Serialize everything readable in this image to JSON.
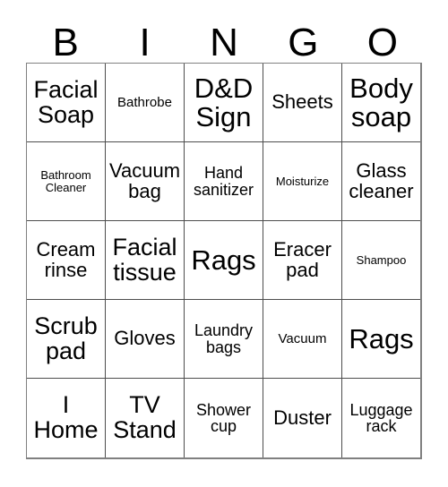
{
  "card": {
    "title": "BINGO",
    "headers": [
      "B",
      "I",
      "N",
      "G",
      "O"
    ],
    "rows": [
      [
        {
          "text": "Facial\nSoap",
          "size": "fs-lg"
        },
        {
          "text": "Bathrobe",
          "size": "fs-xs"
        },
        {
          "text": "D&D\nSign",
          "size": "fs-xl"
        },
        {
          "text": "Sheets",
          "size": "fs-md"
        },
        {
          "text": "Body\nsoap",
          "size": "fs-xl"
        }
      ],
      [
        {
          "text": "Bathroom\nCleaner",
          "size": "fs-xxs"
        },
        {
          "text": "Vacuum\nbag",
          "size": "fs-md"
        },
        {
          "text": "Hand\nsanitizer",
          "size": "fs-sm"
        },
        {
          "text": "Moisturize",
          "size": "fs-xxs"
        },
        {
          "text": "Glass\ncleaner",
          "size": "fs-md"
        }
      ],
      [
        {
          "text": "Cream\nrinse",
          "size": "fs-md"
        },
        {
          "text": "Facial\ntissue",
          "size": "fs-lg"
        },
        {
          "text": "Rags",
          "size": "fs-xl"
        },
        {
          "text": "Eracer\npad",
          "size": "fs-md"
        },
        {
          "text": "Shampoo",
          "size": "fs-xxs"
        }
      ],
      [
        {
          "text": "Scrub\npad",
          "size": "fs-lg"
        },
        {
          "text": "Gloves",
          "size": "fs-md"
        },
        {
          "text": "Laundry\nbags",
          "size": "fs-sm"
        },
        {
          "text": "Vacuum",
          "size": "fs-xs"
        },
        {
          "text": "Rags",
          "size": "fs-xl"
        }
      ],
      [
        {
          "text": "I\nHome",
          "size": "fs-lg"
        },
        {
          "text": "TV\nStand",
          "size": "fs-lg"
        },
        {
          "text": "Shower\ncup",
          "size": "fs-sm"
        },
        {
          "text": "Duster",
          "size": "fs-md"
        },
        {
          "text": "Luggage\nrack",
          "size": "fs-sm"
        }
      ]
    ]
  },
  "colors": {
    "background": "#ffffff",
    "text": "#000000",
    "grid_line": "#4d4d4d",
    "grid_border": "#808080"
  }
}
